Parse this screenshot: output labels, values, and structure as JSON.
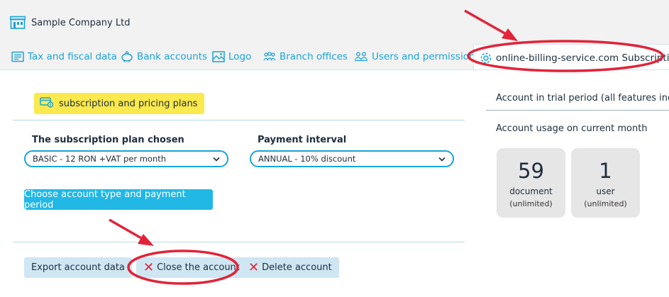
{
  "company": {
    "name": "Sample Company Ltd",
    "icon": "building-icon"
  },
  "tabs": [
    {
      "label": "Tax and fiscal data",
      "icon": "document-icon"
    },
    {
      "label": "Bank accounts",
      "icon": "piggy-bank-icon"
    },
    {
      "label": "Logo",
      "icon": "image-icon"
    },
    {
      "label": "Branch offices",
      "icon": "people-icon"
    },
    {
      "label": "Users and permissions",
      "icon": "users-icon"
    },
    {
      "label": "online-billing-service.com Subscription",
      "icon": "gear-icon",
      "active": true
    }
  ],
  "subscription": {
    "pill_label": "subscription and pricing plans",
    "plan_label": "The subscription plan chosen",
    "plan_value": "BASIC - 12 RON +VAT per month",
    "interval_label": "Payment interval",
    "interval_value": "ANNUAL - 10% discount",
    "choose_button": "Choose account type and payment period"
  },
  "actions": {
    "export": "Export account data",
    "close": "Close the account",
    "delete": "Delete account"
  },
  "account": {
    "trial_text": "Account in trial period (all features include",
    "usage_title": "Account usage on current month",
    "cards": [
      {
        "value": "59",
        "label": "document",
        "limit": "(unlimited)"
      },
      {
        "value": "1",
        "label": "user",
        "limit": "(unlimited)"
      }
    ]
  },
  "colors": {
    "accent": "#1aa3d8",
    "primary_button": "#21b8e6",
    "pill": "#fbe94d",
    "light_button": "#cfe6f3",
    "annotation_red": "#e0243a"
  }
}
